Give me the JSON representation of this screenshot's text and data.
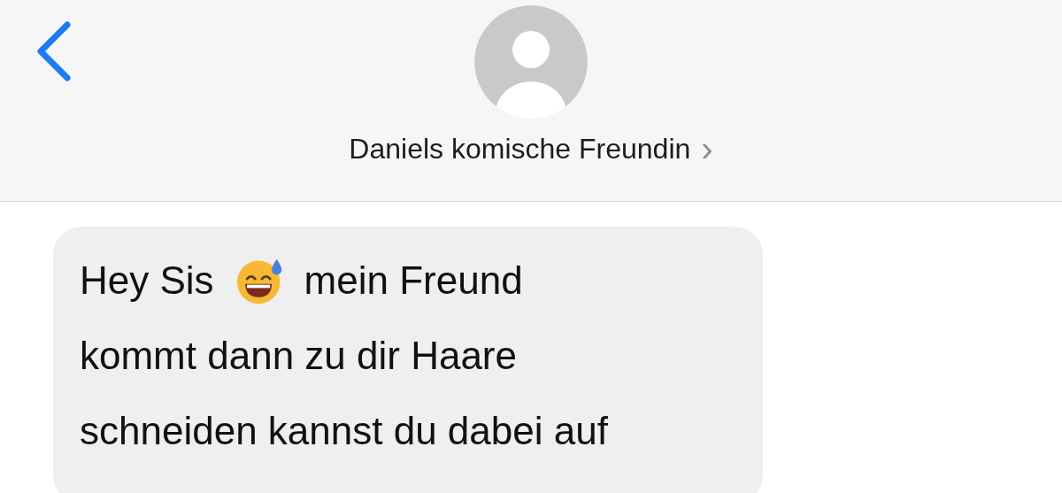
{
  "header": {
    "contact_name": "Daniels komische Freundin",
    "detail_chevron": "›"
  },
  "messages": [
    {
      "kind": "incoming",
      "lines": [
        [
          {
            "kind": "text",
            "text": "Hey Sis"
          },
          {
            "kind": "emoji"
          },
          {
            "kind": "text",
            "text": "mein Freund"
          }
        ],
        [
          {
            "kind": "text",
            "text": "kommt dann zu dir Haare"
          }
        ],
        [
          {
            "kind": "text",
            "text": "schneiden kannst du dabei auf"
          }
        ]
      ]
    }
  ]
}
